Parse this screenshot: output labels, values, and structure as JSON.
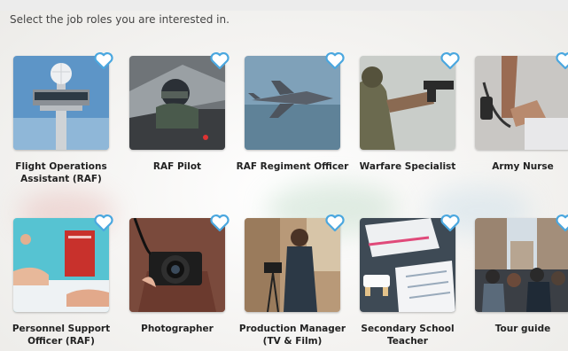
{
  "instruction": "Select the job roles you are interested in.",
  "icons": {
    "favorite": "heart-outline-icon"
  },
  "colors": {
    "heart": "#4aa7df"
  },
  "jobs": [
    {
      "label": "Flight Operations Assistant (RAF)"
    },
    {
      "label": "RAF Pilot"
    },
    {
      "label": "RAF Regiment Officer"
    },
    {
      "label": "Warfare Specialist"
    },
    {
      "label": "Army Nurse"
    },
    {
      "label": "Personnel Support Officer (RAF)"
    },
    {
      "label": "Photographer"
    },
    {
      "label": "Production Manager (TV & Film)"
    },
    {
      "label": "Secondary School Teacher"
    },
    {
      "label": "Tour guide"
    }
  ]
}
